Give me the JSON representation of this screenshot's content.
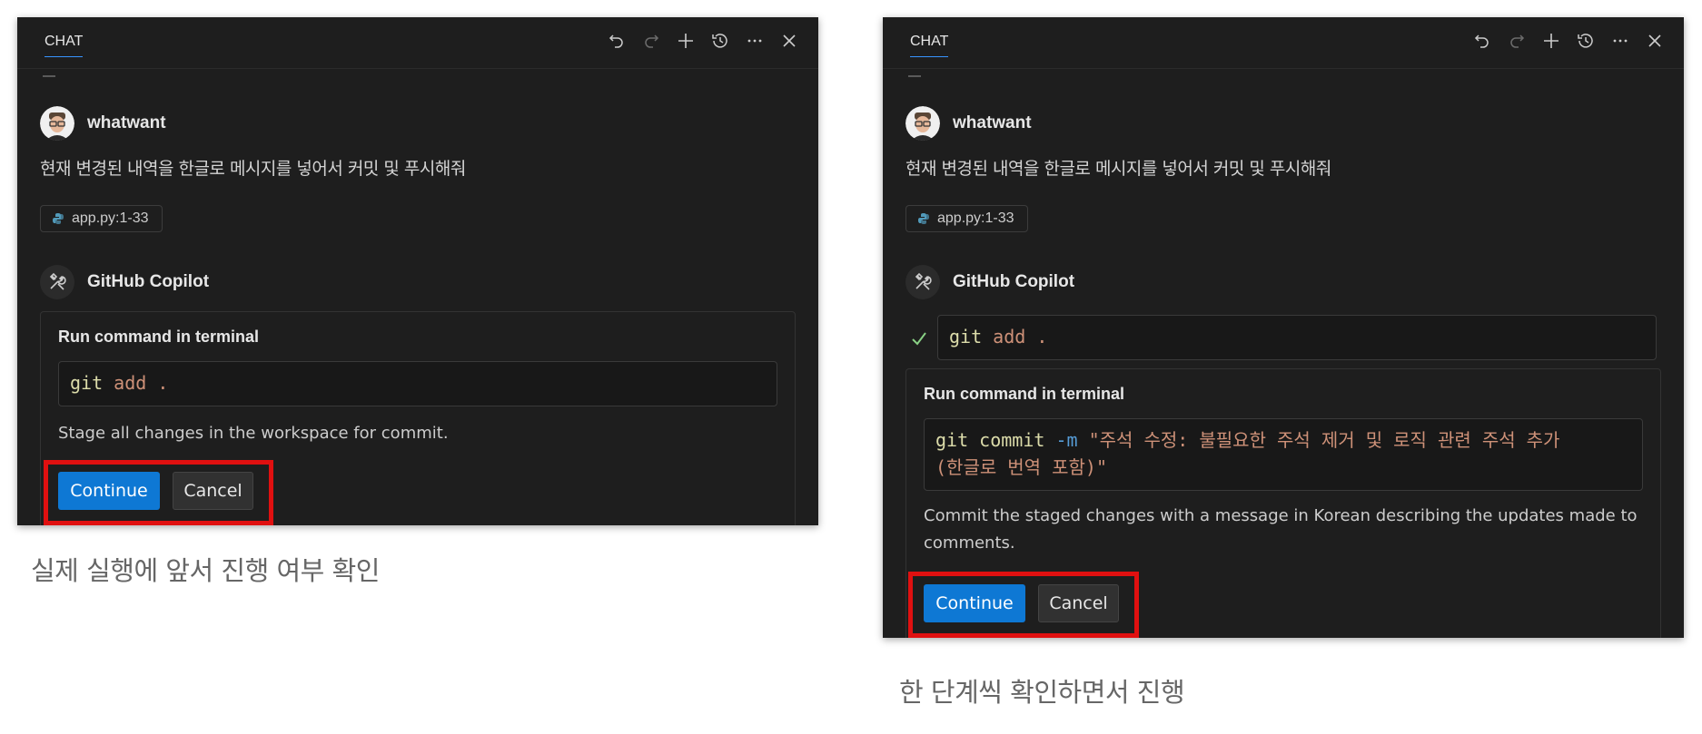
{
  "colors": {
    "panel_bg": "#1e1e1e",
    "accent_blue": "#0e78d4",
    "highlight_red": "#e01010",
    "python_icon_blue": "#519aba",
    "check_green": "#89d185"
  },
  "left": {
    "header": {
      "tab": "CHAT",
      "icons": [
        "undo-icon",
        "redo-icon",
        "plus-icon",
        "history-icon",
        "more-icon",
        "close-icon"
      ]
    },
    "user": {
      "name": "whatwant",
      "message": "현재 변경된 내역을 한글로 메시지를 넣어서 커밋 및 푸시해줘"
    },
    "file_chip": {
      "icon": "python-file-icon",
      "label": "app.py:1-33"
    },
    "assistant": {
      "name": "GitHub Copilot",
      "icon": "tools-icon"
    },
    "run_card": {
      "title": "Run command in terminal",
      "command": {
        "cmd": "git",
        "arg": "add ."
      },
      "description": "Stage all changes in the workspace for commit.",
      "continue_label": "Continue",
      "cancel_label": "Cancel"
    },
    "caption": "실제 실행에 앞서 진행 여부 확인"
  },
  "right": {
    "header": {
      "tab": "CHAT",
      "icons": [
        "undo-icon",
        "redo-icon",
        "plus-icon",
        "history-icon",
        "more-icon",
        "close-icon"
      ]
    },
    "user": {
      "name": "whatwant",
      "message": "현재 변경된 내역을 한글로 메시지를 넣어서 커밋 및 푸시해줘"
    },
    "file_chip": {
      "icon": "python-file-icon",
      "label": "app.py:1-33"
    },
    "assistant": {
      "name": "GitHub Copilot",
      "icon": "tools-icon"
    },
    "done_command": {
      "status_icon": "check-icon",
      "cmd": "git",
      "arg": "add ."
    },
    "run_card": {
      "title": "Run command in terminal",
      "command": {
        "cmd": "git",
        "sub": "commit",
        "flag": "-m",
        "message_line1": "\"주석 수정: 불필요한 주석 제거 및 로직 관련 주석 추가",
        "message_line2": "(한글로 번역 포함)\""
      },
      "description_line1": "Commit the staged changes with a message in Korean describing the updates made to",
      "description_line2": "comments.",
      "continue_label": "Continue",
      "cancel_label": "Cancel"
    },
    "caption": "한 단계씩 확인하면서 진행"
  }
}
